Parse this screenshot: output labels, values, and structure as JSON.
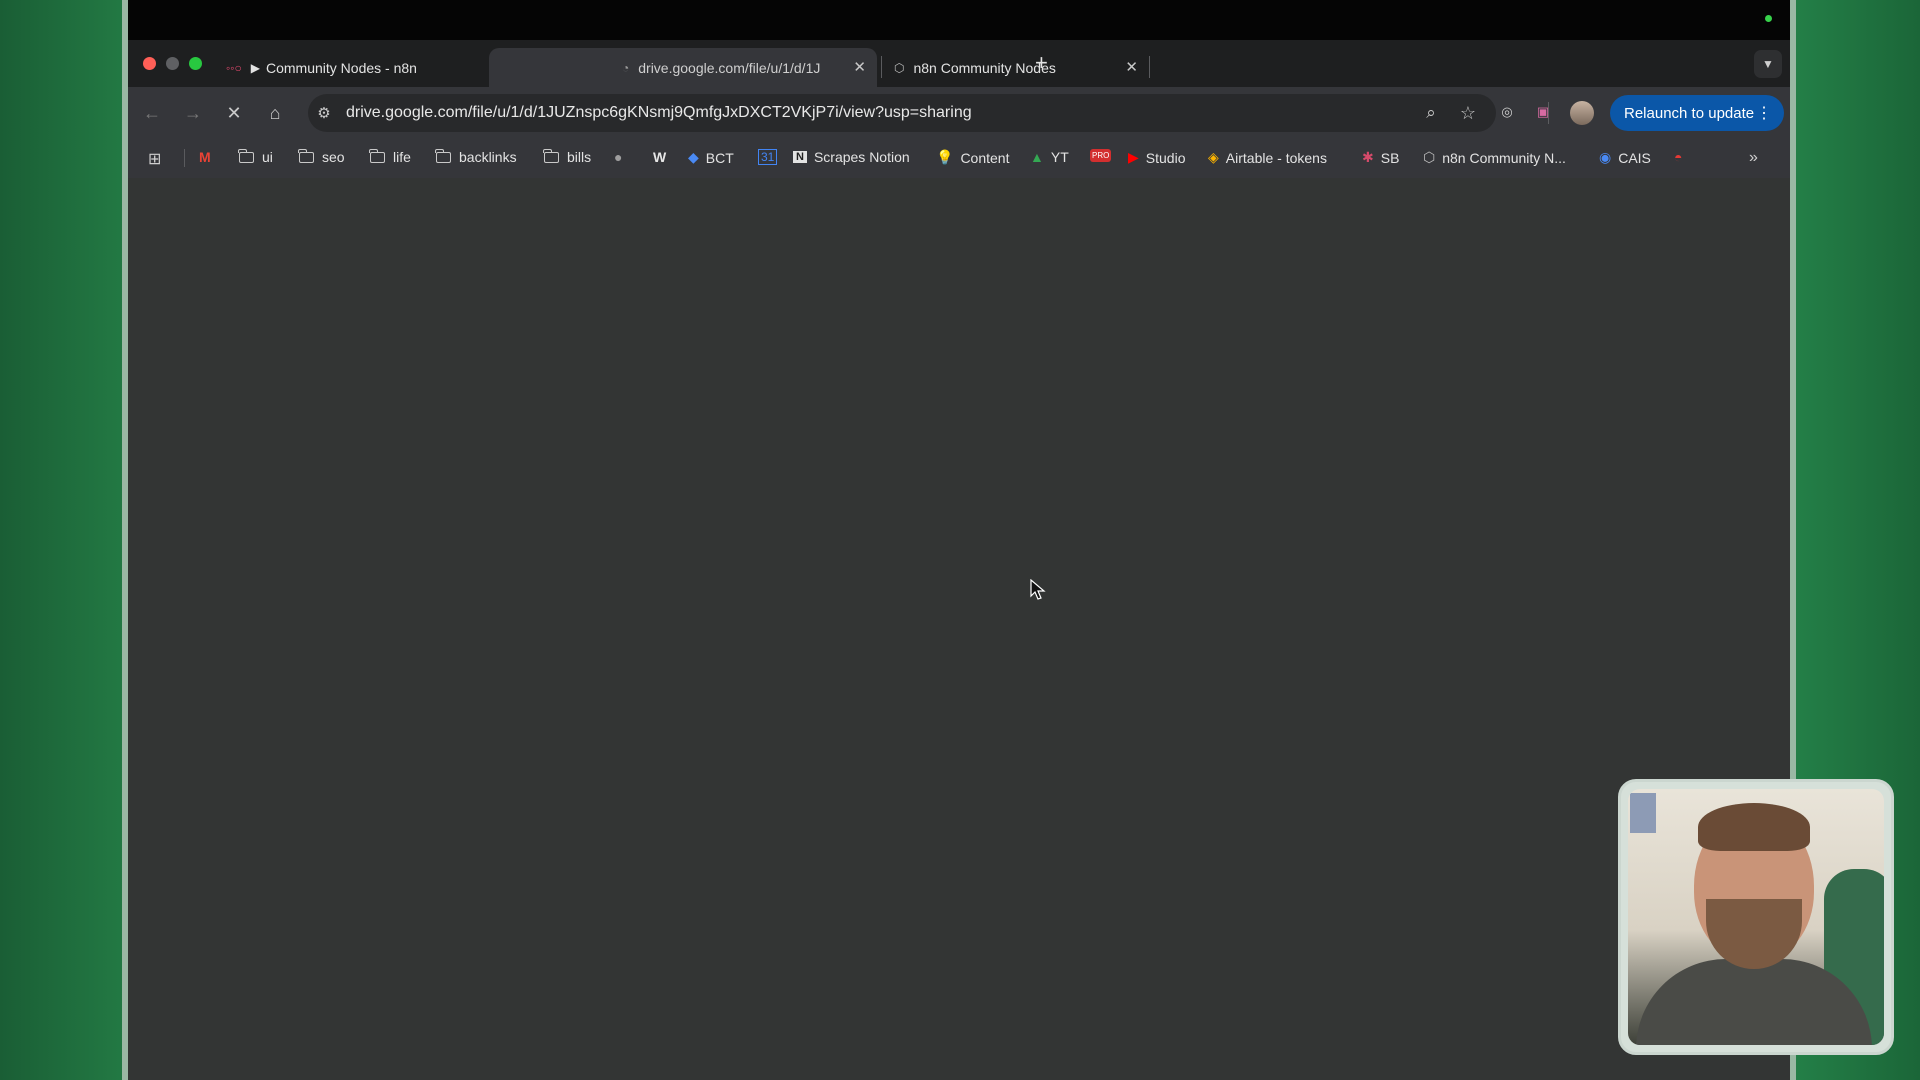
{
  "tabs": [
    {
      "title": "Community Nodes - n8n",
      "icon": "n8n-logo-icon",
      "playing": true,
      "active": false
    },
    {
      "title": "drive.google.com/file/u/1/d/1J",
      "icon": "loading-globe-icon",
      "active": true
    },
    {
      "title": "n8n Community Nodes",
      "icon": "cube-icon",
      "active": false
    }
  ],
  "address_bar": {
    "url": "drive.google.com/file/u/1/d/1JUZnspc6gKNsmj9QmfgJxDXCT2VKjP7i/view?usp=sharing"
  },
  "relaunch_label": "Relaunch to update",
  "bookmarks": [
    {
      "label": "",
      "icon": "gmail-icon"
    },
    {
      "label": "ui",
      "icon": "folder-icon"
    },
    {
      "label": "seo",
      "icon": "folder-icon"
    },
    {
      "label": "life",
      "icon": "folder-icon"
    },
    {
      "label": "backlinks",
      "icon": "folder-icon"
    },
    {
      "label": "bills",
      "icon": "folder-icon"
    },
    {
      "label": "",
      "icon": "spy-icon"
    },
    {
      "label": "",
      "icon": "w-icon"
    },
    {
      "label": "BCT",
      "icon": "bct-icon"
    },
    {
      "label": "",
      "icon": "calendar-icon"
    },
    {
      "label": "Scrapes Notion",
      "icon": "notion-icon"
    },
    {
      "label": "Content",
      "icon": "lightbulb-icon"
    },
    {
      "label": "YT",
      "icon": "drive-icon"
    },
    {
      "label": "",
      "icon": "pro-icon"
    },
    {
      "label": "Studio",
      "icon": "youtube-icon"
    },
    {
      "label": "Airtable - tokens",
      "icon": "airtable-icon"
    },
    {
      "label": "SB",
      "icon": "sb-icon"
    },
    {
      "label": "n8n Community N...",
      "icon": "cube-icon"
    },
    {
      "label": "CAIS",
      "icon": "cais-icon"
    },
    {
      "label": "",
      "icon": "rainbow-icon"
    }
  ],
  "colors": {
    "accent_button": "#0b57a8",
    "page_background": "#333534",
    "desktop": "#1f6b3c"
  }
}
